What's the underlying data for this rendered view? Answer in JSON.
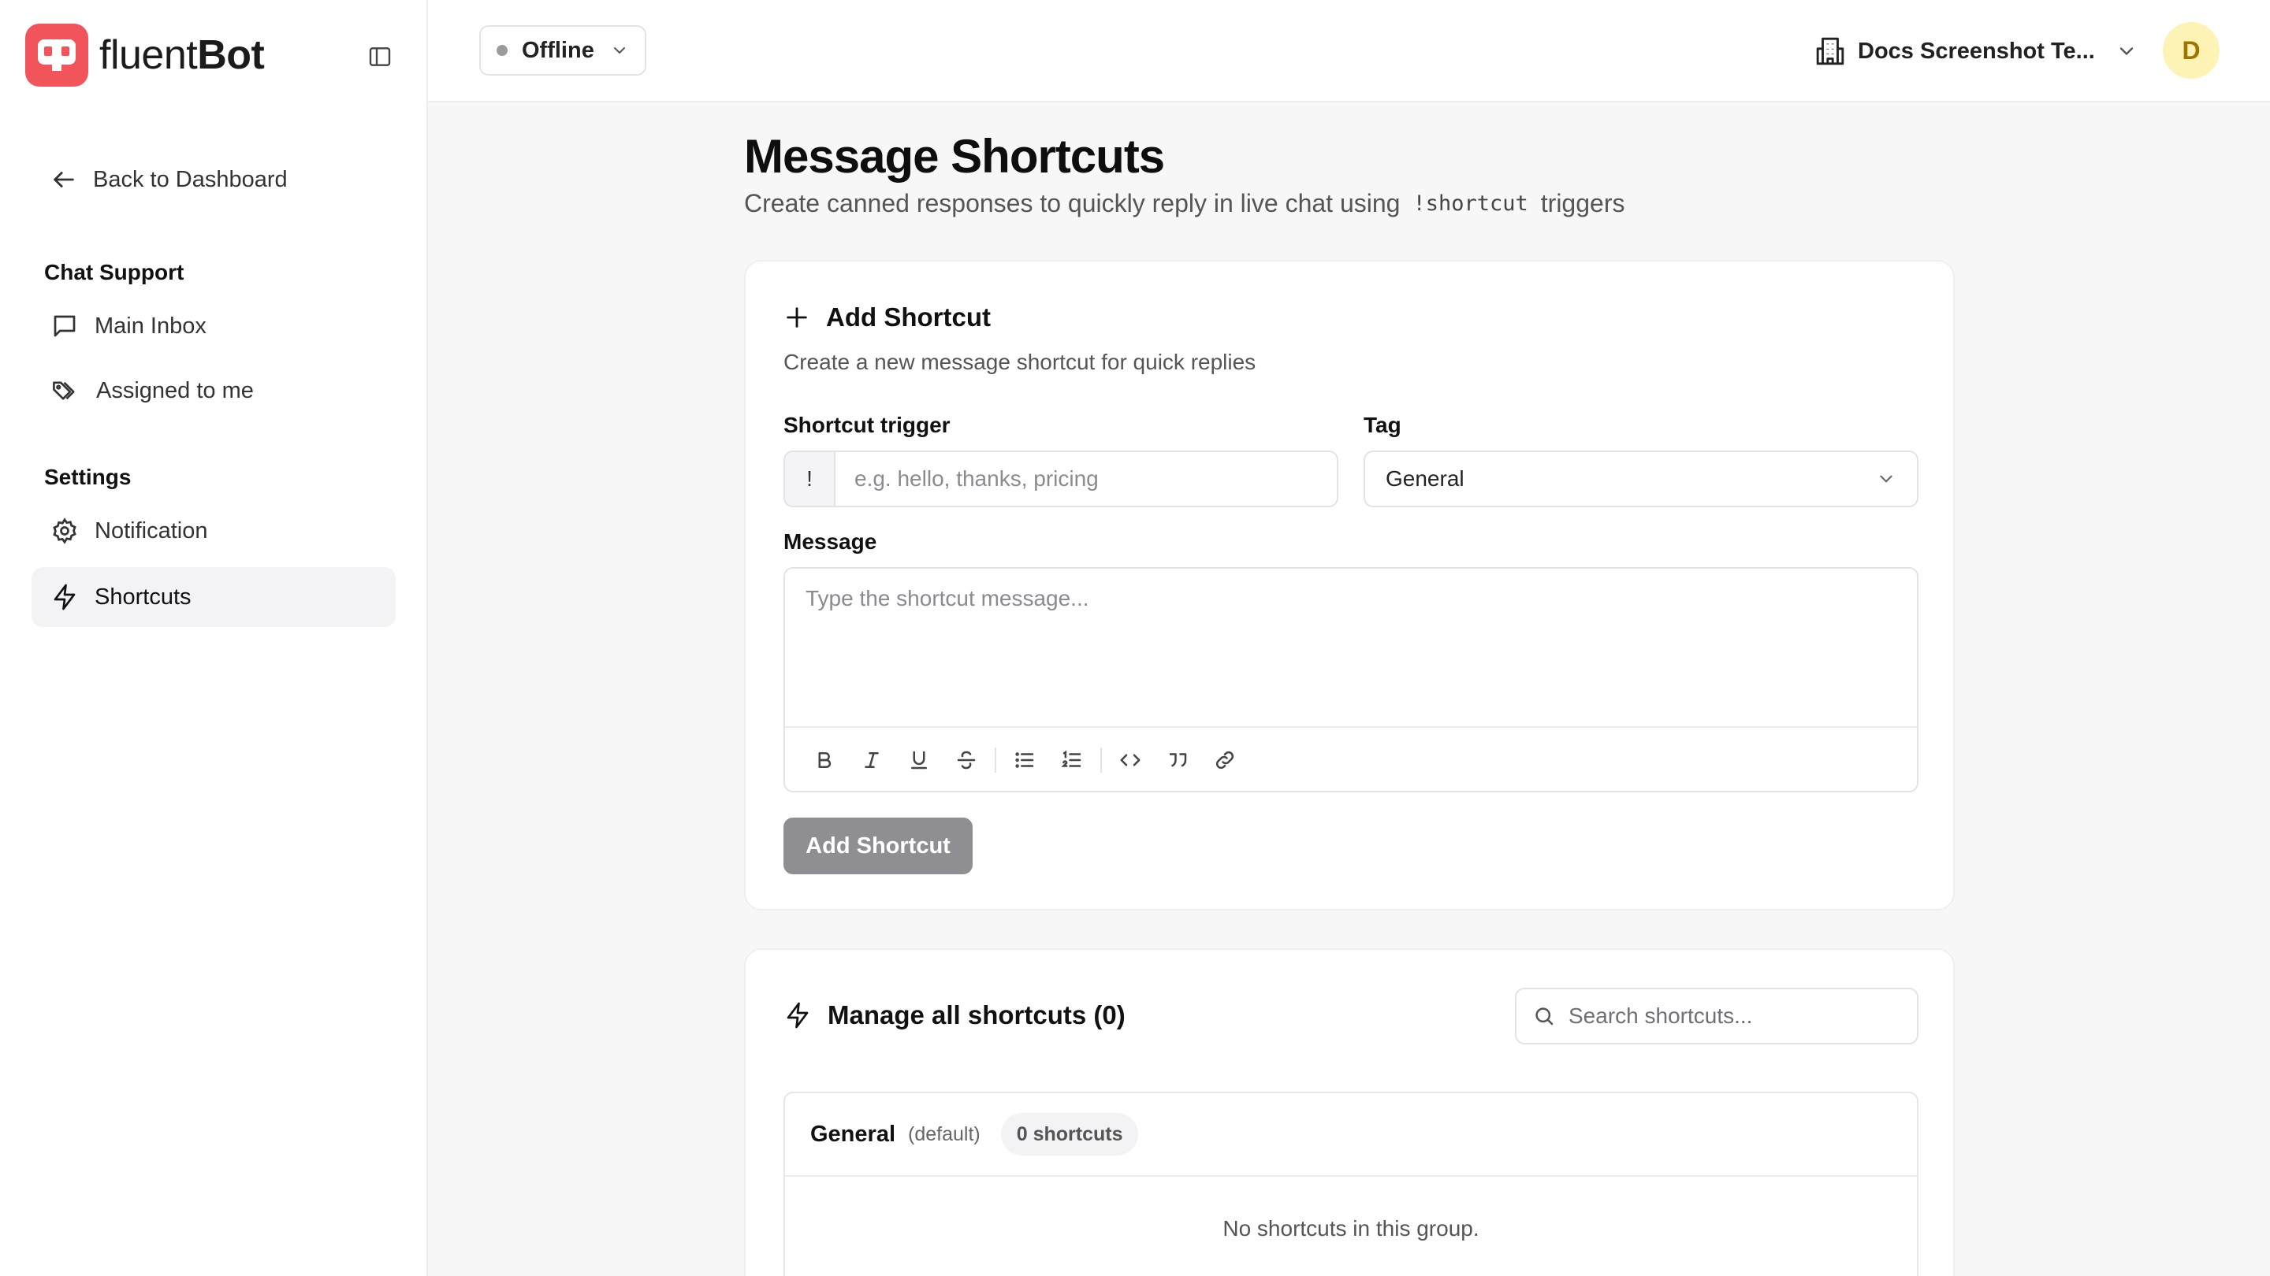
{
  "brand": {
    "name_part1": "fluent",
    "name_part2": "Bot"
  },
  "sidebar": {
    "back_label": "Back to Dashboard",
    "sections": [
      {
        "title": "Chat Support"
      },
      {
        "title": "Settings"
      }
    ],
    "items": [
      {
        "label": "Main Inbox",
        "icon": "message-square-icon"
      },
      {
        "label": "Assigned to me",
        "icon": "tags-icon"
      },
      {
        "label": "Notification",
        "icon": "gear-icon"
      },
      {
        "label": "Shortcuts",
        "icon": "zap-icon",
        "active": true
      }
    ]
  },
  "topbar": {
    "status": "Offline",
    "workspace": "Docs Screenshot Te...",
    "avatar_initial": "D"
  },
  "page": {
    "title": "Message Shortcuts",
    "subtitle_before": "Create canned responses to quickly reply in live chat using",
    "subtitle_code": "!shortcut",
    "subtitle_after": "triggers"
  },
  "add_card": {
    "title": "Add Shortcut",
    "description": "Create a new message shortcut for quick replies",
    "trigger_label": "Shortcut trigger",
    "trigger_prefix": "!",
    "trigger_placeholder": "e.g. hello, thanks, pricing",
    "tag_label": "Tag",
    "tag_value": "General",
    "message_label": "Message",
    "message_placeholder": "Type the shortcut message...",
    "submit_label": "Add Shortcut"
  },
  "manage_card": {
    "title": "Manage all shortcuts (0)",
    "search_placeholder": "Search shortcuts...",
    "groups": [
      {
        "name": "General",
        "note": "(default)",
        "count": "0 shortcuts",
        "empty_text": "No shortcuts in this group."
      }
    ]
  },
  "colors": {
    "brand": "#f2545b",
    "disabled_button": "#8f8f93",
    "avatar_bg": "#fdf3b5"
  }
}
